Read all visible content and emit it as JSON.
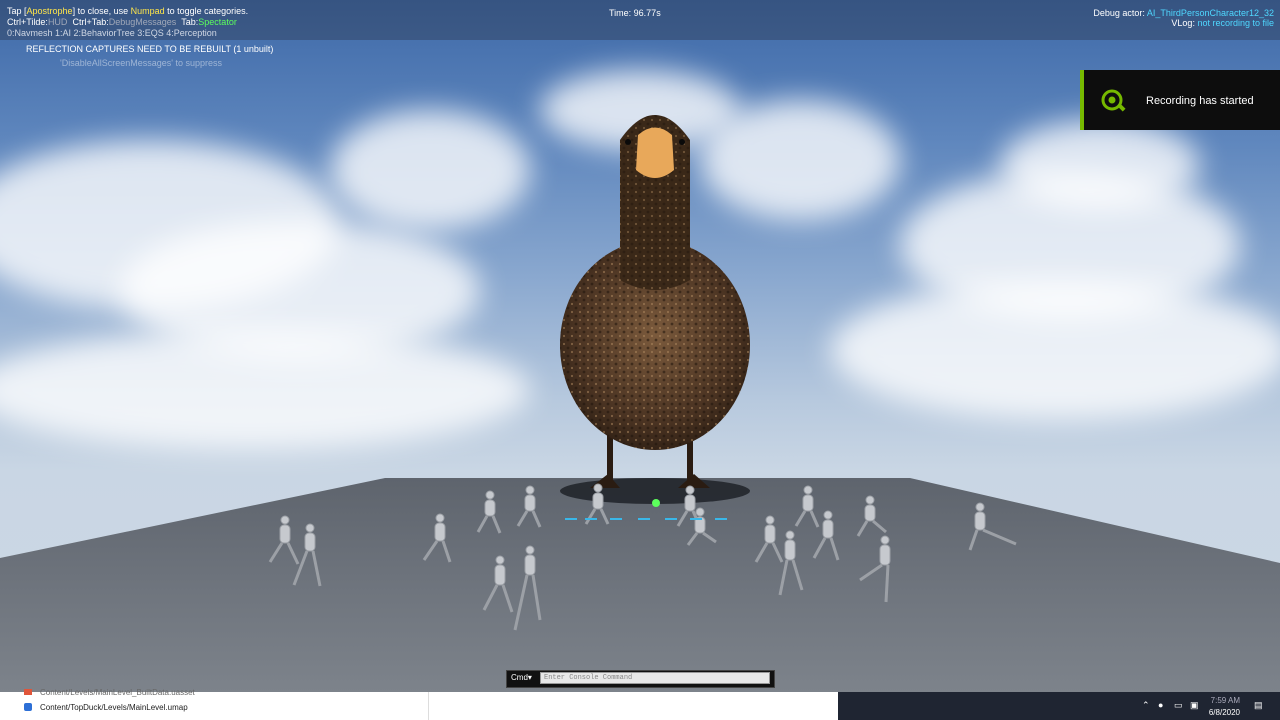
{
  "hud": {
    "line1_pre": "Tap [",
    "line1_key1": "Apostrophe",
    "line1_mid": "] to close, use ",
    "line1_key2": "Numpad",
    "line1_post": " to toggle categories.",
    "line2_a": "Ctrl+Tilde:",
    "line2_a_val": "HUD",
    "line2_b": "Ctrl+Tab:",
    "line2_b_val": "DebugMessages",
    "line2_c": "Tab:",
    "line2_c_val": "Spectator",
    "line3": "0:Navmesh  1:AI  2:BehaviorTree  3:EQS  4:Perception",
    "warning": "REFLECTION CAPTURES NEED TO BE REBUILT (1 unbuilt)",
    "disable_msg": "'DisableAllScreenMessages' to suppress",
    "time": "Time: 96.77s",
    "debug_actor_label": "Debug actor: ",
    "debug_actor_value": "AI_ThirdPersonCharacter12_32",
    "vlog_label": "VLog: ",
    "vlog_value": "not recording to file"
  },
  "recording": {
    "label": "Recording has started",
    "icon": "geforce-record-icon",
    "accent": "#76b900"
  },
  "console": {
    "cmd_label": "Cmd▾",
    "placeholder": "Enter Console Command"
  },
  "taskbar": {
    "files": [
      "Content/Levels/MainLevel_BuiltData.uasset",
      "Content/TopDuck/Levels/MainLevel.umap"
    ],
    "time": "7:59 AM",
    "date": "6/8/2020"
  }
}
